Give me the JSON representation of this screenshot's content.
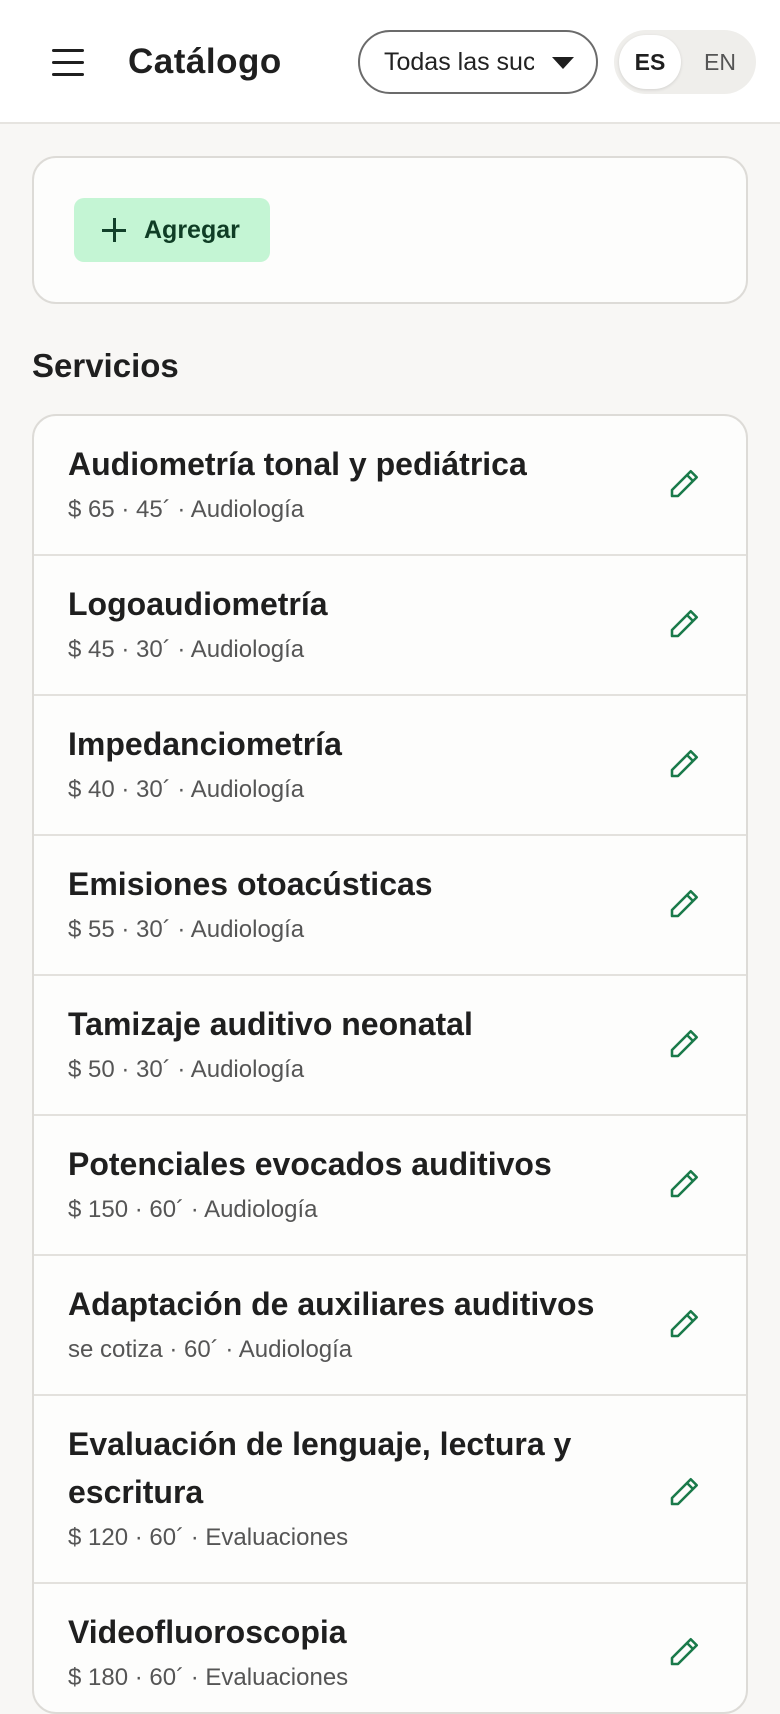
{
  "header": {
    "title": "Catálogo",
    "branch_select": {
      "value": "Todas las sucursales"
    },
    "languages": [
      {
        "code": "ES",
        "active": true
      },
      {
        "code": "EN",
        "active": false
      }
    ]
  },
  "actions": {
    "add_label": "Agregar"
  },
  "section_title": "Servicios",
  "services": [
    {
      "name": "Audiometría tonal y pediátrica",
      "meta": "$ 65 · 45´ · Audiología"
    },
    {
      "name": "Logoaudiometría",
      "meta": "$ 45 · 30´ · Audiología"
    },
    {
      "name": "Impedanciometría",
      "meta": "$ 40 · 30´ · Audiología"
    },
    {
      "name": "Emisiones otoacústicas",
      "meta": "$ 55 · 30´ · Audiología"
    },
    {
      "name": "Tamizaje auditivo neonatal",
      "meta": "$ 50 · 30´ · Audiología"
    },
    {
      "name": "Potenciales evocados auditivos",
      "meta": "$ 150 · 60´ · Audiología"
    },
    {
      "name": "Adaptación de auxiliares auditivos",
      "meta": "se cotiza · 60´ · Audiología"
    },
    {
      "name": "Evaluación de lenguaje, lectura y escritura",
      "meta": "$ 120 · 60´ · Evaluaciones"
    },
    {
      "name": "Videofluoroscopia",
      "meta": "$ 180 · 60´ · Evaluaciones"
    }
  ],
  "colors": {
    "accent": "#c4f5d4",
    "accent_text": "#0f3d25",
    "icon": "#1a7a4a"
  }
}
